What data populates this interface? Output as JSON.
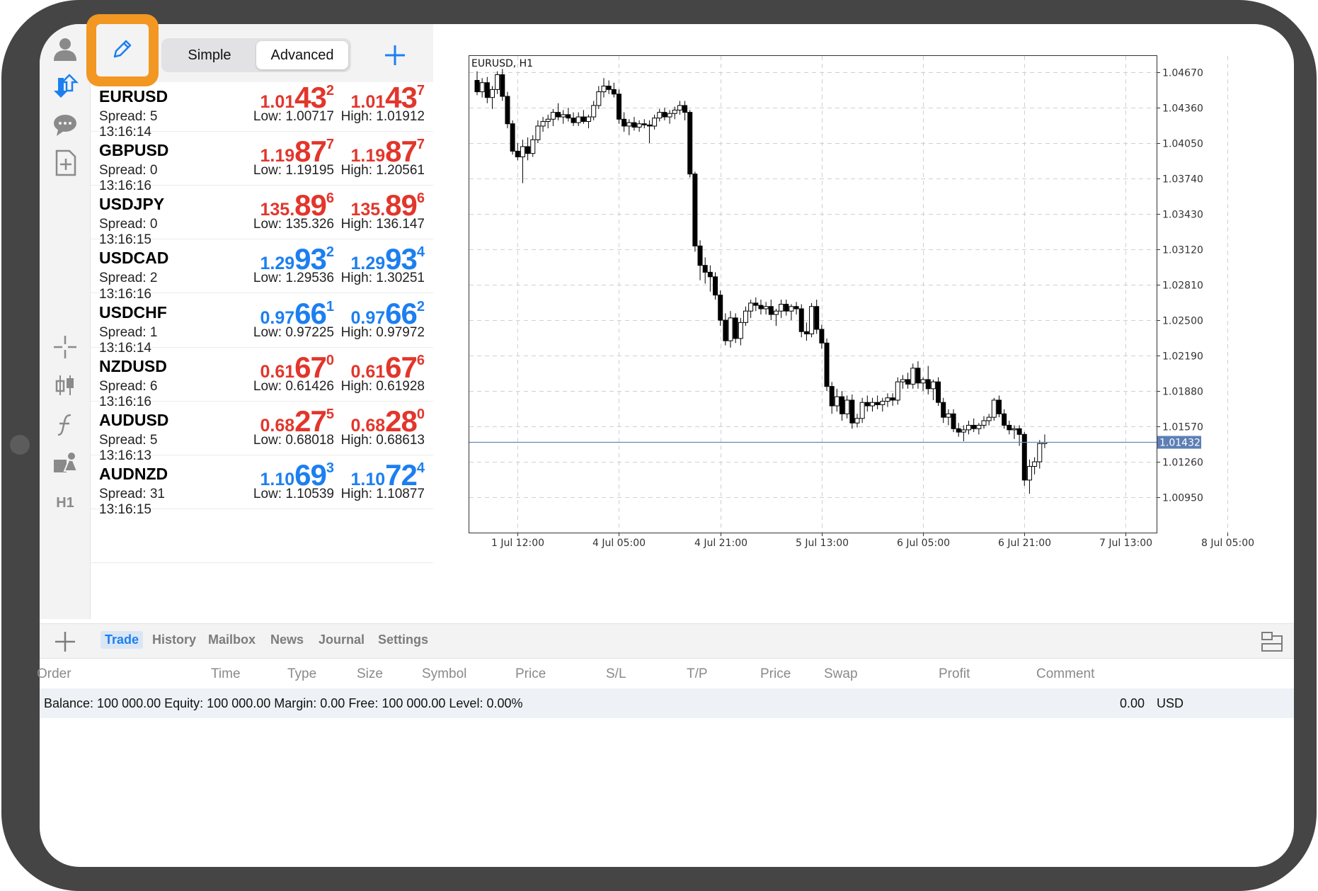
{
  "toolbar": {
    "mode_simple": "Simple",
    "mode_advanced": "Advanced",
    "timeframe": "H1",
    "icons": [
      "account-icon",
      "quotes-icon",
      "chat-icon",
      "new-order-icon",
      "crosshair-icon",
      "chart-type-icon",
      "indicators-icon",
      "objects-icon",
      "edit-icon",
      "add-icon"
    ],
    "highlight_color": "#f29722"
  },
  "quotes": [
    {
      "time": "13:16:16",
      "symbol": "EURUSD",
      "spread": "Spread: 5",
      "dir": "down",
      "bid": {
        "small": "1.01",
        "big": "43",
        "sup": "2"
      },
      "ask": {
        "small": "1.01",
        "big": "43",
        "sup": "7"
      },
      "low": "Low: 1.00717",
      "high": "High: 1.01912"
    },
    {
      "time": "13:16:14",
      "symbol": "GBPUSD",
      "spread": "Spread: 0",
      "dir": "down",
      "bid": {
        "small": "1.19",
        "big": "87",
        "sup": "7"
      },
      "ask": {
        "small": "1.19",
        "big": "87",
        "sup": "7"
      },
      "low": "Low: 1.19195",
      "high": "High: 1.20561"
    },
    {
      "time": "13:16:16",
      "symbol": "USDJPY",
      "spread": "Spread: 0",
      "dir": "down",
      "bid": {
        "small": "135.",
        "big": "89",
        "sup": "6"
      },
      "ask": {
        "small": "135.",
        "big": "89",
        "sup": "6"
      },
      "low": "Low: 135.326",
      "high": "High: 136.147"
    },
    {
      "time": "13:16:15",
      "symbol": "USDCAD",
      "spread": "Spread: 2",
      "dir": "up",
      "bid": {
        "small": "1.29",
        "big": "93",
        "sup": "2"
      },
      "ask": {
        "small": "1.29",
        "big": "93",
        "sup": "4"
      },
      "low": "Low: 1.29536",
      "high": "High: 1.30251"
    },
    {
      "time": "13:16:16",
      "symbol": "USDCHF",
      "spread": "Spread: 1",
      "dir": "up",
      "bid": {
        "small": "0.97",
        "big": "66",
        "sup": "1"
      },
      "ask": {
        "small": "0.97",
        "big": "66",
        "sup": "2"
      },
      "low": "Low: 0.97225",
      "high": "High: 0.97972"
    },
    {
      "time": "13:16:14",
      "symbol": "NZDUSD",
      "spread": "Spread: 6",
      "dir": "down",
      "bid": {
        "small": "0.61",
        "big": "67",
        "sup": "0"
      },
      "ask": {
        "small": "0.61",
        "big": "67",
        "sup": "6"
      },
      "low": "Low: 0.61426",
      "high": "High: 0.61928"
    },
    {
      "time": "13:16:16",
      "symbol": "AUDUSD",
      "spread": "Spread: 5",
      "dir": "down",
      "bid": {
        "small": "0.68",
        "big": "27",
        "sup": "5"
      },
      "ask": {
        "small": "0.68",
        "big": "28",
        "sup": "0"
      },
      "low": "Low: 0.68018",
      "high": "High: 0.68613"
    },
    {
      "time": "13:16:13",
      "symbol": "AUDNZD",
      "spread": "Spread: 31",
      "dir": "up",
      "bid": {
        "small": "1.10",
        "big": "69",
        "sup": "3"
      },
      "ask": {
        "small": "1.10",
        "big": "72",
        "sup": "4"
      },
      "low": "Low: 1.10539",
      "high": "High: 1.10877"
    },
    {
      "time": "13:16:15",
      "symbol": "",
      "spread": "",
      "dir": "up",
      "bid": {
        "small": "",
        "big": "",
        "sup": ""
      },
      "ask": {
        "small": "",
        "big": "",
        "sup": ""
      },
      "low": "",
      "high": ""
    }
  ],
  "chart_data": {
    "type": "candlestick",
    "title": "EURUSD, H1",
    "ylim": [
      1.0064,
      1.0482
    ],
    "y_ticks": [
      "1.04670",
      "1.04360",
      "1.04050",
      "1.03740",
      "1.03430",
      "1.03120",
      "1.02810",
      "1.02500",
      "1.02190",
      "1.01880",
      "1.01570",
      "1.01260",
      "1.00950"
    ],
    "y_tick_values": [
      1.0467,
      1.0436,
      1.0405,
      1.0374,
      1.0343,
      1.0312,
      1.0281,
      1.025,
      1.0219,
      1.0188,
      1.0157,
      1.0126,
      1.0095
    ],
    "x_ticks": [
      "1 Jul 12:00",
      "4 Jul 05:00",
      "4 Jul 21:00",
      "5 Jul 13:00",
      "6 Jul 05:00",
      "6 Jul 21:00",
      "7 Jul 13:00",
      "8 Jul 05:00"
    ],
    "x_tick_candle_index": [
      8,
      28,
      48,
      68,
      88,
      108,
      128,
      148
    ],
    "current_price": "1.01432",
    "current_price_value": 1.01432,
    "grid": true,
    "candles_ohlc": [
      [
        1.046,
        1.0468,
        1.0447,
        1.045
      ],
      [
        1.045,
        1.0462,
        1.0445,
        1.0458
      ],
      [
        1.0458,
        1.0463,
        1.044,
        1.0445
      ],
      [
        1.0445,
        1.0455,
        1.0435,
        1.0452
      ],
      [
        1.0452,
        1.0468,
        1.0448,
        1.0465
      ],
      [
        1.0465,
        1.047,
        1.0442,
        1.0446
      ],
      [
        1.0446,
        1.045,
        1.0418,
        1.0422
      ],
      [
        1.0422,
        1.0425,
        1.0395,
        1.0398
      ],
      [
        1.0398,
        1.0405,
        1.039,
        1.0393
      ],
      [
        1.0393,
        1.0408,
        1.037,
        1.0402
      ],
      [
        1.0402,
        1.041,
        1.039,
        1.0396
      ],
      [
        1.0396,
        1.0412,
        1.0393,
        1.0408
      ],
      [
        1.0408,
        1.0425,
        1.0405,
        1.042
      ],
      [
        1.042,
        1.0428,
        1.0415,
        1.0424
      ],
      [
        1.0424,
        1.043,
        1.0418,
        1.0426
      ],
      [
        1.0426,
        1.0435,
        1.042,
        1.0432
      ],
      [
        1.0432,
        1.044,
        1.0425,
        1.0428
      ],
      [
        1.0428,
        1.0434,
        1.0422,
        1.043
      ],
      [
        1.043,
        1.0436,
        1.0424,
        1.0427
      ],
      [
        1.0427,
        1.0432,
        1.042,
        1.0423
      ],
      [
        1.0423,
        1.0432,
        1.042,
        1.0428
      ],
      [
        1.0428,
        1.0434,
        1.0422,
        1.0424
      ],
      [
        1.0424,
        1.043,
        1.0418,
        1.0428
      ],
      [
        1.0428,
        1.0442,
        1.0425,
        1.0438
      ],
      [
        1.0438,
        1.0455,
        1.0435,
        1.045
      ],
      [
        1.045,
        1.0462,
        1.0445,
        1.0455
      ],
      [
        1.0455,
        1.046,
        1.0448,
        1.0452
      ],
      [
        1.0452,
        1.0458,
        1.0445,
        1.0448
      ],
      [
        1.0448,
        1.0452,
        1.0422,
        1.0426
      ],
      [
        1.0426,
        1.0432,
        1.0415,
        1.042
      ],
      [
        1.042,
        1.0426,
        1.0412,
        1.0423
      ],
      [
        1.0423,
        1.0428,
        1.0416,
        1.0419
      ],
      [
        1.0419,
        1.0425,
        1.0415,
        1.0422
      ],
      [
        1.0422,
        1.0426,
        1.0418,
        1.0421
      ],
      [
        1.0421,
        1.0425,
        1.0405,
        1.042
      ],
      [
        1.042,
        1.043,
        1.0417,
        1.0427
      ],
      [
        1.0427,
        1.0435,
        1.0424,
        1.0432
      ],
      [
        1.0432,
        1.0436,
        1.0425,
        1.0428
      ],
      [
        1.0428,
        1.0434,
        1.0422,
        1.0431
      ],
      [
        1.0431,
        1.0437,
        1.0426,
        1.0434
      ],
      [
        1.0434,
        1.0442,
        1.043,
        1.0438
      ],
      [
        1.0438,
        1.0442,
        1.0425,
        1.0432
      ],
      [
        1.0432,
        1.0434,
        1.0375,
        1.0378
      ],
      [
        1.0378,
        1.038,
        1.031,
        1.0315
      ],
      [
        1.0315,
        1.032,
        1.0285,
        1.0298
      ],
      [
        1.0298,
        1.0305,
        1.0282,
        1.0292
      ],
      [
        1.0292,
        1.0298,
        1.0275,
        1.0288
      ],
      [
        1.0288,
        1.0292,
        1.0268,
        1.0272
      ],
      [
        1.0272,
        1.0276,
        1.0245,
        1.025
      ],
      [
        1.025,
        1.0256,
        1.0228,
        1.0232
      ],
      [
        1.0232,
        1.0258,
        1.0226,
        1.0252
      ],
      [
        1.0252,
        1.0256,
        1.023,
        1.0234
      ],
      [
        1.0234,
        1.0252,
        1.0228,
        1.0248
      ],
      [
        1.0248,
        1.0262,
        1.0245,
        1.0258
      ],
      [
        1.0258,
        1.0268,
        1.0252,
        1.0265
      ],
      [
        1.0265,
        1.027,
        1.0258,
        1.0263
      ],
      [
        1.0263,
        1.0268,
        1.0255,
        1.026
      ],
      [
        1.026,
        1.0266,
        1.0255,
        1.0262
      ],
      [
        1.0262,
        1.0268,
        1.025,
        1.0255
      ],
      [
        1.0255,
        1.026,
        1.0245,
        1.0258
      ],
      [
        1.0258,
        1.0268,
        1.0252,
        1.0264
      ],
      [
        1.0264,
        1.0268,
        1.0254,
        1.0258
      ],
      [
        1.0258,
        1.0264,
        1.025,
        1.0262
      ],
      [
        1.0262,
        1.0266,
        1.0255,
        1.026
      ],
      [
        1.026,
        1.0264,
        1.0235,
        1.024
      ],
      [
        1.024,
        1.0248,
        1.0232,
        1.0238
      ],
      [
        1.0238,
        1.0265,
        1.0235,
        1.0262
      ],
      [
        1.0262,
        1.0268,
        1.0238,
        1.0242
      ],
      [
        1.0242,
        1.0246,
        1.0225,
        1.023
      ],
      [
        1.023,
        1.0234,
        1.0188,
        1.0192
      ],
      [
        1.0192,
        1.0196,
        1.0168,
        1.0175
      ],
      [
        1.0175,
        1.019,
        1.017,
        1.0183
      ],
      [
        1.0183,
        1.0188,
        1.0162,
        1.0168
      ],
      [
        1.0168,
        1.0184,
        1.0164,
        1.018
      ],
      [
        1.018,
        1.0185,
        1.0155,
        1.016
      ],
      [
        1.016,
        1.0168,
        1.0156,
        1.0164
      ],
      [
        1.0164,
        1.0182,
        1.016,
        1.0178
      ],
      [
        1.0178,
        1.0184,
        1.017,
        1.0175
      ],
      [
        1.0175,
        1.0182,
        1.017,
        1.0178
      ],
      [
        1.0178,
        1.0184,
        1.0172,
        1.0176
      ],
      [
        1.0176,
        1.0182,
        1.017,
        1.0179
      ],
      [
        1.0179,
        1.0186,
        1.0174,
        1.0182
      ],
      [
        1.0182,
        1.0186,
        1.0175,
        1.018
      ],
      [
        1.018,
        1.02,
        1.0176,
        1.0196
      ],
      [
        1.0196,
        1.0202,
        1.019,
        1.0198
      ],
      [
        1.0198,
        1.0204,
        1.019,
        1.0194
      ],
      [
        1.0194,
        1.0212,
        1.019,
        1.0208
      ],
      [
        1.0208,
        1.0214,
        1.019,
        1.0195
      ],
      [
        1.0195,
        1.02,
        1.0188,
        1.0198
      ],
      [
        1.0198,
        1.021,
        1.0185,
        1.019
      ],
      [
        1.019,
        1.0198,
        1.018,
        1.0196
      ],
      [
        1.0196,
        1.02,
        1.0175,
        1.0178
      ],
      [
        1.0178,
        1.0182,
        1.016,
        1.0165
      ],
      [
        1.0165,
        1.0172,
        1.0158,
        1.0168
      ],
      [
        1.0168,
        1.0172,
        1.0152,
        1.0155
      ],
      [
        1.0155,
        1.016,
        1.0148,
        1.0152
      ],
      [
        1.0152,
        1.0158,
        1.0144,
        1.0154
      ],
      [
        1.0154,
        1.0162,
        1.015,
        1.0158
      ],
      [
        1.0158,
        1.0164,
        1.0152,
        1.0155
      ],
      [
        1.0155,
        1.016,
        1.015,
        1.0158
      ],
      [
        1.0158,
        1.0166,
        1.0155,
        1.0162
      ],
      [
        1.0162,
        1.0168,
        1.0158,
        1.0165
      ],
      [
        1.0165,
        1.0182,
        1.0162,
        1.018
      ],
      [
        1.018,
        1.0184,
        1.0165,
        1.0168
      ],
      [
        1.0168,
        1.0172,
        1.0155,
        1.0158
      ],
      [
        1.0158,
        1.0162,
        1.015,
        1.0154
      ],
      [
        1.0154,
        1.0158,
        1.0146,
        1.0155
      ],
      [
        1.0155,
        1.0158,
        1.014,
        1.015
      ],
      [
        1.015,
        1.0152,
        1.0105,
        1.011
      ],
      [
        1.011,
        1.0128,
        1.0098,
        1.0122
      ],
      [
        1.0122,
        1.013,
        1.0115,
        1.0126
      ],
      [
        1.0126,
        1.0145,
        1.012,
        1.0142
      ],
      [
        1.0142,
        1.015,
        1.0138,
        1.0143
      ]
    ]
  },
  "bottom_tabs": [
    "Trade",
    "History",
    "Mailbox",
    "News",
    "Journal",
    "Settings"
  ],
  "orders_columns": [
    "Order",
    "Time",
    "Type",
    "Size",
    "Symbol",
    "Price",
    "S/L",
    "T/P",
    "Price",
    "Swap",
    "Profit",
    "Comment"
  ],
  "balance": {
    "text": "Balance: 100 000.00 Equity: 100 000.00 Margin: 0.00 Free: 100 000.00 Level: 0.00%",
    "profit": "0.00",
    "currency": "USD"
  }
}
